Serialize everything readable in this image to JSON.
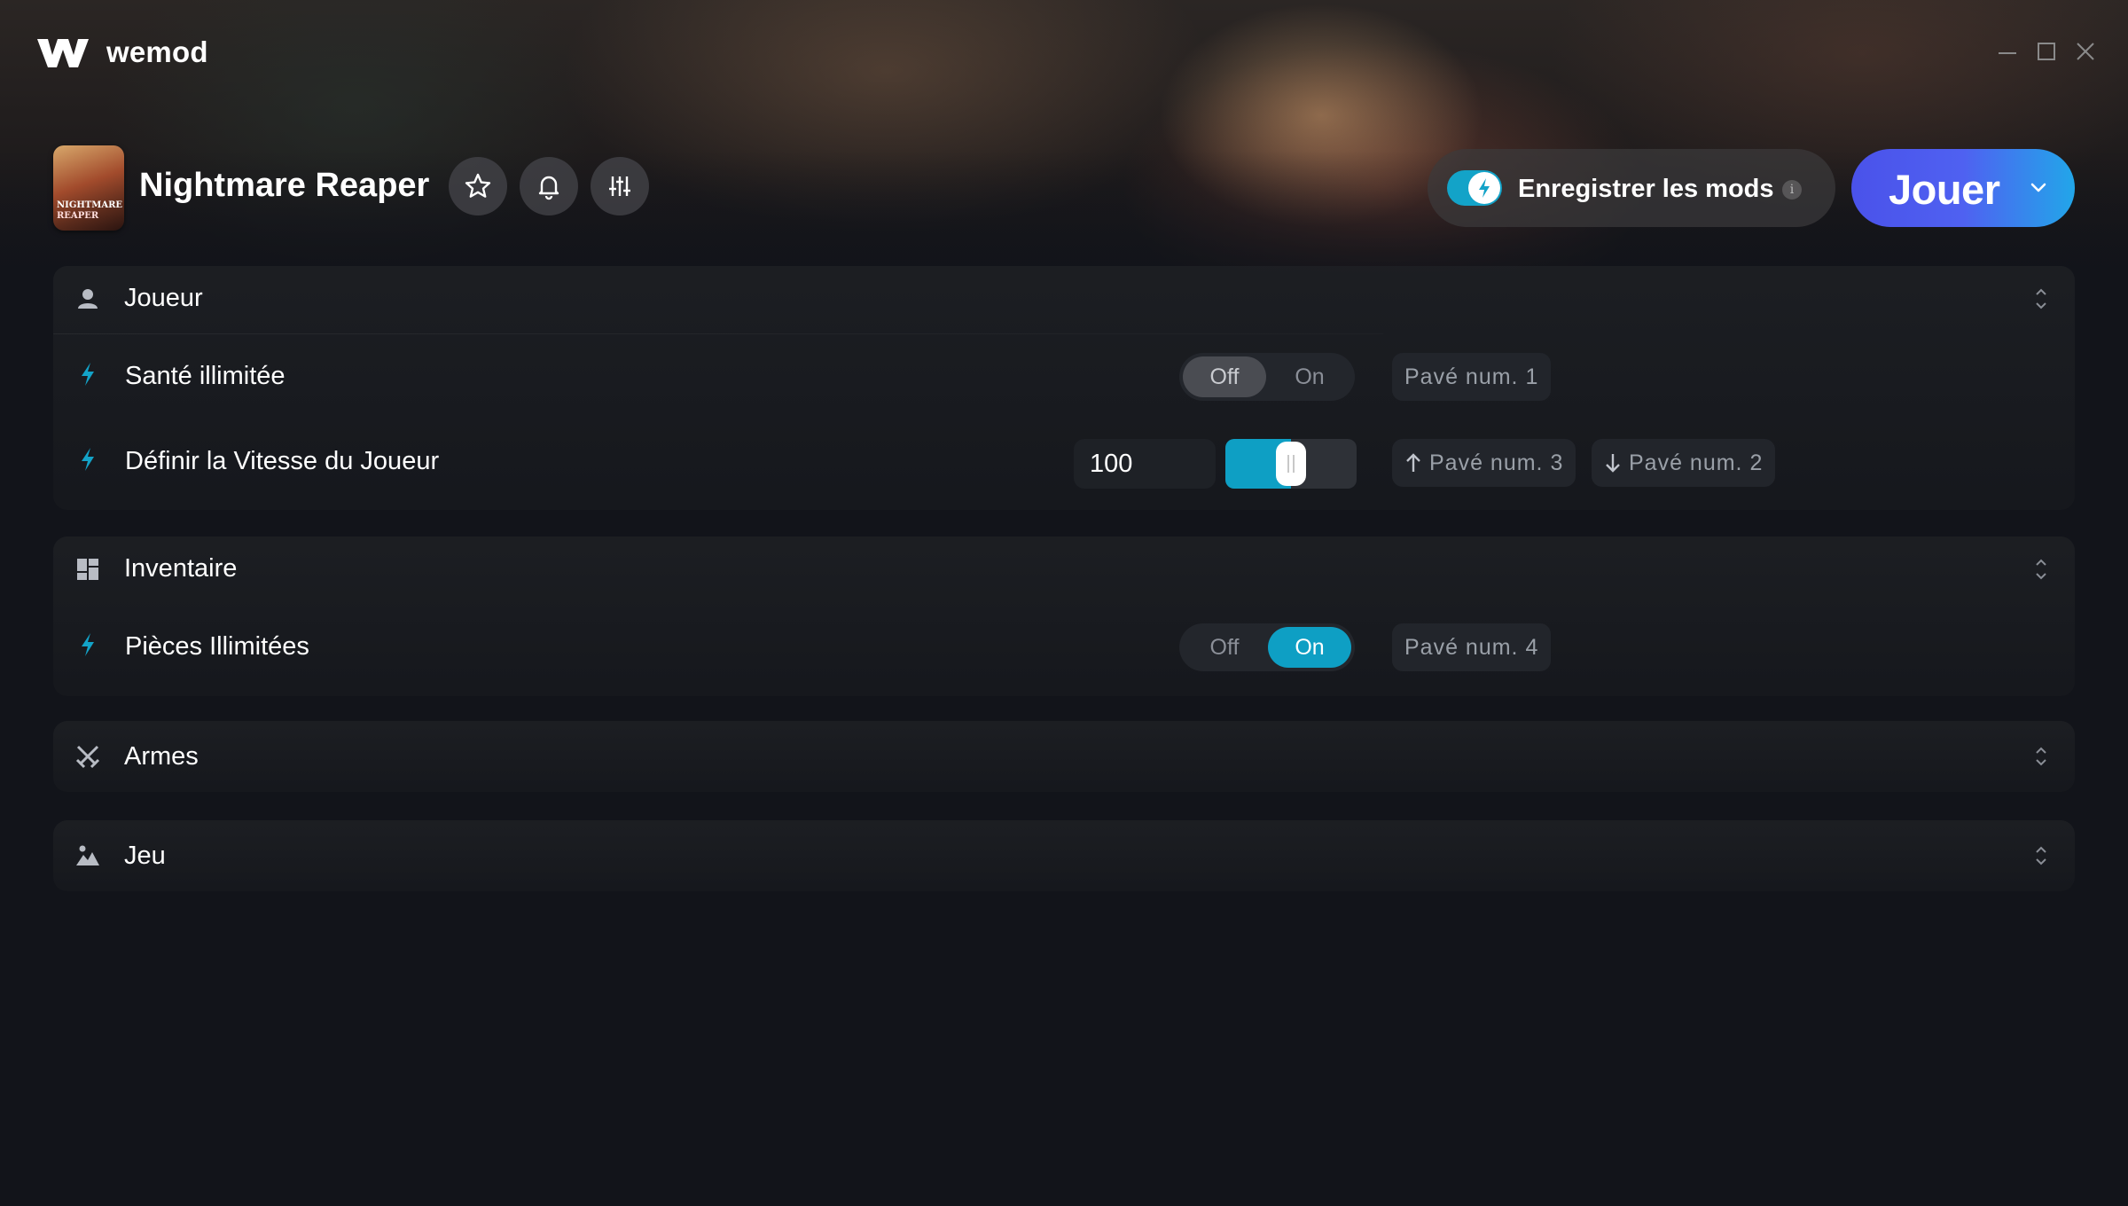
{
  "app": {
    "brand": "wemod"
  },
  "window_controls": {
    "icons": [
      "minimize-icon",
      "maximize-icon",
      "close-icon"
    ]
  },
  "game": {
    "title": "Nightmare Reaper",
    "thumb_line1": "NIGHTMARE",
    "thumb_line2": "REAPER"
  },
  "header_actions": {
    "icons": [
      "star-icon",
      "bell-icon",
      "sliders-icon"
    ],
    "record_mods_label": "Enregistrer les mods",
    "record_mods_enabled": true,
    "info_label": "i",
    "play_label": "Jouer"
  },
  "sections": {
    "player": {
      "title": "Joueur",
      "mods": {
        "health": {
          "label": "Santé illimitée",
          "off_label": "Off",
          "on_label": "On",
          "state": "off",
          "hotkey": "Pavé num. 1"
        },
        "speed": {
          "label": "Définir la Vitesse du Joueur",
          "value": "100",
          "slider_fraction": 0.5,
          "hotkey_up": "Pavé num. 3",
          "hotkey_down": "Pavé num. 2"
        }
      }
    },
    "inventory": {
      "title": "Inventaire",
      "mods": {
        "coins": {
          "label": "Pièces Illimitées",
          "off_label": "Off",
          "on_label": "On",
          "state": "on",
          "hotkey": "Pavé num. 4"
        }
      }
    },
    "weapons": {
      "title": "Armes"
    },
    "game": {
      "title": "Jeu"
    }
  },
  "colors": {
    "accent": "#0e9fc4",
    "play_gradient_start": "#4a52ea",
    "play_gradient_end": "#22a6e9",
    "background": "#12141a"
  }
}
